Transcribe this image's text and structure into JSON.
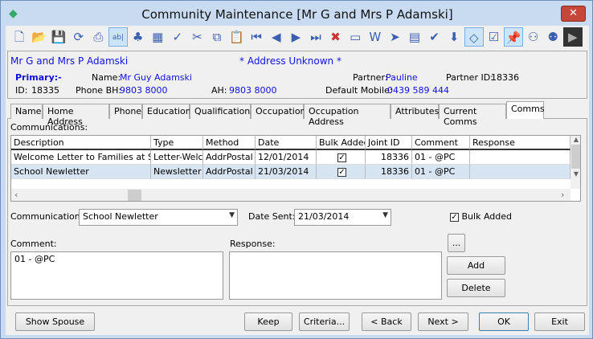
{
  "window": {
    "title": "Community Maintenance  [Mr G and Mrs P Adamski]",
    "close": "✕"
  },
  "toolbar": [
    "new-icon",
    "open-icon",
    "save-icon",
    "refresh-icon",
    "print-icon",
    "text-field-icon",
    "tree-icon",
    "calculator-icon",
    "spellcheck-icon",
    "cut-icon",
    "copy-icon",
    "paste-icon",
    "first-icon",
    "previous-icon",
    "next-icon",
    "last-icon",
    "delete-icon",
    "card-icon",
    "word-icon",
    "export-icon",
    "clipboard-icon",
    "approve-icon",
    "download-icon",
    "tag-icon",
    "checklist-icon",
    "pin-icon",
    "people-sync-icon",
    "people-link-icon",
    "exit-flag-icon"
  ],
  "header": {
    "name": "Mr G and Mrs P Adamski",
    "address_status": "* Address Unknown *",
    "primary_label": "Primary:-",
    "name_label": "Name:",
    "name_value": "Mr Guy Adamski",
    "partner_label": "Partner:",
    "partner_value": "Pauline",
    "partner_id_label": "Partner ID:",
    "partner_id_value": "18336",
    "id_label": "ID:",
    "id_value": "18335",
    "phone_bh_label": "Phone BH:",
    "phone_bh_value": "9803 8000",
    "ah_label": "AH:",
    "ah_value": "9803 8000",
    "mobile_label": "Default Mobile:",
    "mobile_value": "0439 589 444"
  },
  "tabs": [
    "Name",
    "Home Address",
    "Phone",
    "Education",
    "Qualifications",
    "Occupation",
    "Occupation Address",
    "Attributes",
    "Current Comms",
    "Comms"
  ],
  "active_tab": "Comms",
  "comms": {
    "label": "Communications:",
    "columns": [
      "Description",
      "Type",
      "Method",
      "Date",
      "Bulk Added",
      "Joint ID",
      "Comment",
      "Response"
    ],
    "rows": [
      {
        "description": "Welcome Letter to Families at Start",
        "type": "Letter-Welco",
        "method": "AddrPostal",
        "date": "12/01/2014",
        "bulk_added": true,
        "joint_id": "18336",
        "comment": "01 - @PC",
        "response": ""
      },
      {
        "description": "School Newletter",
        "type": "Newsletter",
        "method": "AddrPostal",
        "date": "21/03/2014",
        "bulk_added": true,
        "joint_id": "18336",
        "comment": "01 - @PC",
        "response": "",
        "selected": true
      }
    ]
  },
  "form": {
    "communication_label": "Communication:",
    "communication_value": "School Newletter",
    "date_sent_label": "Date Sent:",
    "date_sent_value": "21/03/2014",
    "bulk_added_label": "Bulk Added",
    "bulk_added": true,
    "comment_label": "Comment:",
    "comment_value": "01 - @PC",
    "response_label": "Response:",
    "response_value": "",
    "ellipsis": "...",
    "add": "Add",
    "delete": "Delete"
  },
  "buttons": {
    "show_spouse": "Show Spouse",
    "keep": "Keep",
    "criteria": "Criteria...",
    "back": "< Back",
    "next": "Next >",
    "ok": "OK",
    "exit": "Exit"
  }
}
